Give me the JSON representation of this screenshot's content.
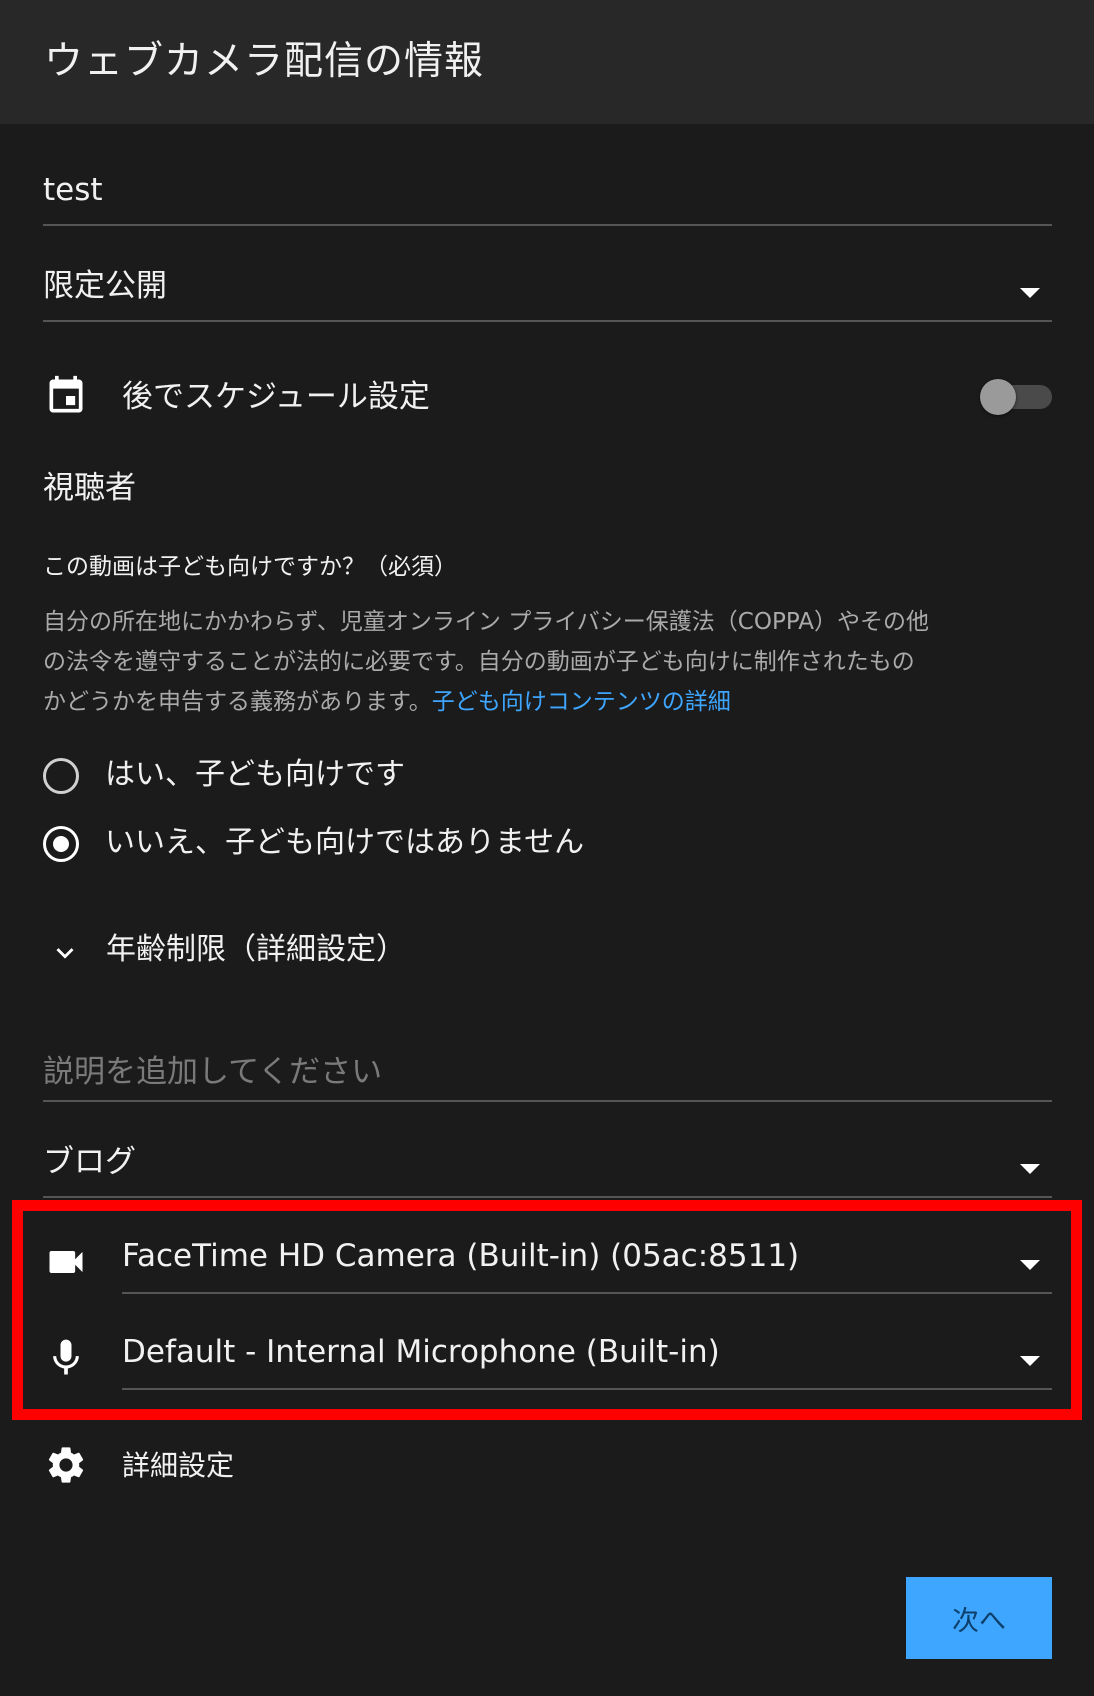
{
  "header": {
    "title": "ウェブカメラ配信の情報"
  },
  "title_field": {
    "value": "test"
  },
  "visibility": {
    "selected": "限定公開"
  },
  "schedule": {
    "label": "後でスケジュール設定",
    "icon": "calendar-icon",
    "enabled": false
  },
  "audience": {
    "heading": "視聴者",
    "question": "この動画は子ども向けですか？（必須）",
    "description_line1": "自分の所在地にかかわらず、児童オンライン プライバシー保護法（COPPA）やその他",
    "description_line2": "の法令を遵守することが法的に必要です。自分の動画が子ども向けに制作されたもの",
    "description_line3": "かどうかを申告する義務があります。",
    "link_text": "子ども向けコンテンツの詳細",
    "options": [
      {
        "label": "はい、子ども向けです",
        "selected": false
      },
      {
        "label": "いいえ、子ども向けではありません",
        "selected": true
      }
    ],
    "age_restriction_label": "年齢制限（詳細設定）"
  },
  "description_field": {
    "placeholder": "説明を追加してください"
  },
  "category": {
    "selected": "ブログ"
  },
  "camera": {
    "icon": "videocam-icon",
    "selected": "FaceTime HD Camera (Built-in) (05ac:8511)"
  },
  "microphone": {
    "icon": "mic-icon",
    "selected": "Default - Internal Microphone (Built-in)"
  },
  "advanced": {
    "icon": "gear-icon",
    "label": "詳細設定"
  },
  "footer": {
    "next_label": "次へ"
  },
  "colors": {
    "background": "#1b1b1b",
    "header_background": "#282828",
    "accent_blue": "#3ea6ff",
    "highlight_red": "#ff0000"
  }
}
